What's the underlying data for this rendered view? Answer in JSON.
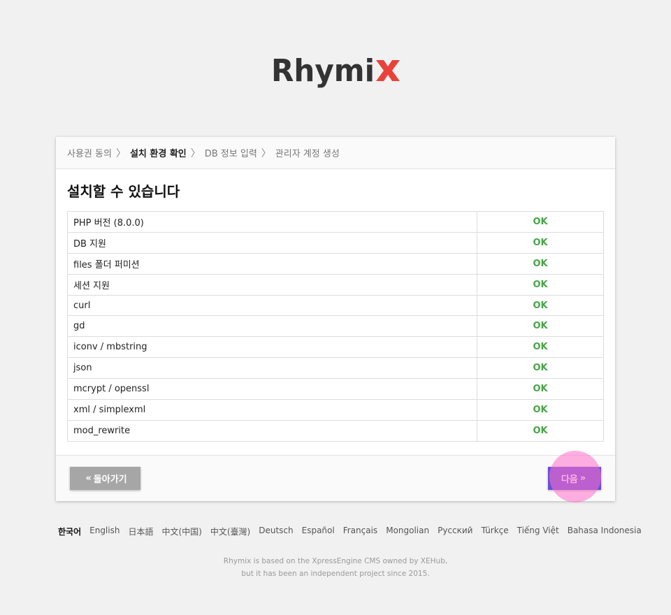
{
  "logo": {
    "text": "Rhymix",
    "accent_color": "#e8423b",
    "text_color": "#333333"
  },
  "steps": [
    {
      "label": "사용권 동의",
      "active": false
    },
    {
      "label": "설치 환경 확인",
      "active": true
    },
    {
      "label": "DB 정보 입력",
      "active": false
    },
    {
      "label": "관리자 계정 생성",
      "active": false
    }
  ],
  "heading": "설치할 수 있습니다",
  "checks": [
    {
      "name": "PHP 버전 (8.0.0)",
      "result": "OK"
    },
    {
      "name": "DB 지원",
      "result": "OK"
    },
    {
      "name": "files 폴더 퍼미션",
      "result": "OK"
    },
    {
      "name": "세션 지원",
      "result": "OK"
    },
    {
      "name": "curl",
      "result": "OK"
    },
    {
      "name": "gd",
      "result": "OK"
    },
    {
      "name": "iconv / mbstring",
      "result": "OK"
    },
    {
      "name": "json",
      "result": "OK"
    },
    {
      "name": "mcrypt / openssl",
      "result": "OK"
    },
    {
      "name": "xml / simplexml",
      "result": "OK"
    },
    {
      "name": "mod_rewrite",
      "result": "OK"
    }
  ],
  "buttons": {
    "back_label": "돌아가기",
    "next_label": "다음"
  },
  "languages": [
    {
      "label": "한국어",
      "current": true
    },
    {
      "label": "English",
      "current": false
    },
    {
      "label": "日本語",
      "current": false
    },
    {
      "label": "中文(中国)",
      "current": false
    },
    {
      "label": "中文(臺灣)",
      "current": false
    },
    {
      "label": "Deutsch",
      "current": false
    },
    {
      "label": "Español",
      "current": false
    },
    {
      "label": "Français",
      "current": false
    },
    {
      "label": "Mongolian",
      "current": false
    },
    {
      "label": "Русский",
      "current": false
    },
    {
      "label": "Türkçe",
      "current": false
    },
    {
      "label": "Tiếng Việt",
      "current": false
    },
    {
      "label": "Bahasa Indonesia",
      "current": false
    }
  ],
  "credits": {
    "line1": "Rhymix is based on the XpressEngine CMS owned by XEHub,",
    "line2": "but it has been an independent project since 2015."
  },
  "colors": {
    "ok": "#47a447",
    "next_button": "#6a4fd8",
    "back_button": "#a6a6a6"
  }
}
